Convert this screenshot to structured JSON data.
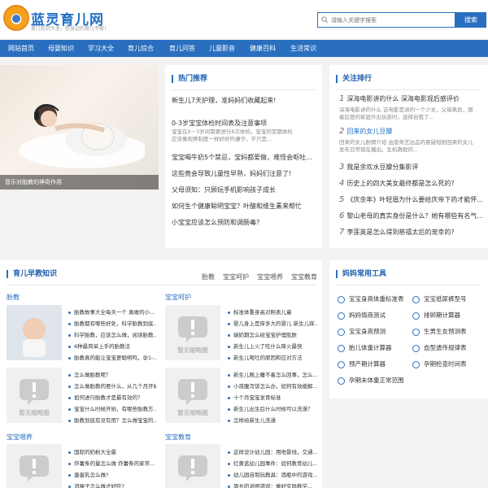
{
  "site": {
    "name": "蓝灵育儿网",
    "slogan": "育儿知识大全，您身边的育儿专家！"
  },
  "search": {
    "placeholder": "请输入关键字搜索",
    "button": "搜索"
  },
  "nav": [
    "网站首页",
    "母婴知识",
    "学习大全",
    "育儿综合",
    "育儿问答",
    "儿童影音",
    "健康百科",
    "生活常识"
  ],
  "hero": {
    "caption": "音乐对胎教的神奇作用"
  },
  "hot": {
    "title": "热门推荐",
    "items": [
      "新生儿7天护理，准妈妈们收藏起来!",
      "0-3岁宝宝体检时间表及注意事项",
      "宝宝喝牛奶5个禁忌，宝妈都爱做，难怪会呕吐...",
      "这些竟会导致儿童性早熟，妈妈们注意了!",
      "父母须知：只顾玩手机影响孩子成长",
      "如何生个健康聪明宝宝？叶酸和维生素来帮忙",
      "小宝宝应该怎么预防和调肠毒?"
    ],
    "item1_desc": [
      "宝宝在0－3岁间需要进行8次体检。宝宝的定期体检",
      "应该像观察制度一样好好的遵守，不只是..."
    ],
    "line2": "0-3岁宝宝体检时间表及注意事项"
  },
  "rank": {
    "title": "关注排行",
    "items": [
      {
        "num": "1",
        "text": "深海电影讲的什么 深海电影观后感评价",
        "highlight": false
      },
      {
        "num": "2",
        "text": "回来的女儿豆瓣",
        "highlight": true
      },
      {
        "num": "3",
        "text": "我是余欢水豆瓣分集影评",
        "highlight": false
      },
      {
        "num": "4",
        "text": "历史上的四大美女最终都是怎么死的?",
        "highlight": false
      },
      {
        "num": "5",
        "text": "《庆余年》叶轻眉为什么要给庆帝下药才能怀...",
        "highlight": false
      },
      {
        "num": "6",
        "text": "黎山老母的真实身份是什么？她有哪些有名气...",
        "highlight": false
      },
      {
        "num": "7",
        "text": "李莲英是怎么得到慈禧太后的宠幸的?",
        "highlight": false
      }
    ],
    "desc1": [
      "深海电影讲的什么 这电影是讲的一个少女，父母离异，跟",
      "着后爸的家庭外出玩耍时，选择自我了..."
    ],
    "desc2": [
      "回来的女儿剧情介绍 由爱奇艺出品的悬疑短剧回来的女儿",
      "发布日常现在播出。生机救助的..."
    ]
  },
  "knowledge": {
    "title": "育儿早教知识",
    "tabs": [
      "胎教",
      "宝宝呵护",
      "宝宝喂养",
      "宝宝教育"
    ],
    "sections": [
      {
        "label": "胎教",
        "items": [
          "胎教故事大全每天一个 勇敢的小...",
          "胎教都有哪些好处，科学胎教到底...",
          "科学胎教，应该怎么做，阅读胎教...",
          "6种最简单上手的胎教法",
          "胎教真的能让宝宝更聪明吗，孕1-..."
        ]
      },
      {
        "label": "宝宝呵护",
        "items": [
          "标准体重身高对照表儿童",
          "婴儿身上是痒多大的婴儿 新生儿痒...",
          "端奶期怎么给宝宝护理肌肤",
          "新生儿上火了吃什么降火最快",
          "新生儿呕吐的原因和应对方法"
        ]
      },
      {
        "label": "宝宝喂养",
        "items": [
          "国际的奶粉大全最",
          "炸薯条的量怎么做 炸薯条的家常...",
          "蛋蛋乳怎么做?",
          "消瘦子怎么做才好吃?"
        ]
      },
      {
        "label": "宝宝教育",
        "items": [
          "这样设计幼儿园：用地景线，交通...",
          "红黄蓝幼儿园事件：如何教育幼儿...",
          "幼儿园自制玩教具：酒瓶中的游戏...",
          "周长的说明游戏：做好实践教学..."
        ]
      }
    ],
    "row2a": [
      "怎么做胎教呢？",
      "怎么做胎教的要什么，从几个月开始...",
      "如何进行胎教才是最有效的？",
      "宝宝什么时候开始，有哪些胎教方...",
      "胎教到底有没有用？怎么做宝宝的..."
    ],
    "row2b": [
      "新生儿晚上睡不着怎么回事，怎么...",
      "小孩腹泻该怎么办，如何有效缓解...",
      "十个月宝宝发育标准",
      "新生儿出生后什么时候可以洗澡？",
      "怎样给新生儿洗澡"
    ],
    "placeholder_text": "暂无缩略图"
  },
  "tools": {
    "title": "妈妈常用工具",
    "items": [
      "宝宝身高体重标准表",
      "宝宝纸尿裤型号",
      "妈妈情商测试",
      "排卵期计算器",
      "宝宝身高预测",
      "生男生女预测表",
      "胎儿体重计算器",
      "血型遗传规律表",
      "预产期计算器",
      "孕期检查时间表",
      "孕期末体重正常范围"
    ]
  },
  "colors": {
    "brand": "#2a6fbf",
    "brand_text": "#1f6fc5"
  }
}
